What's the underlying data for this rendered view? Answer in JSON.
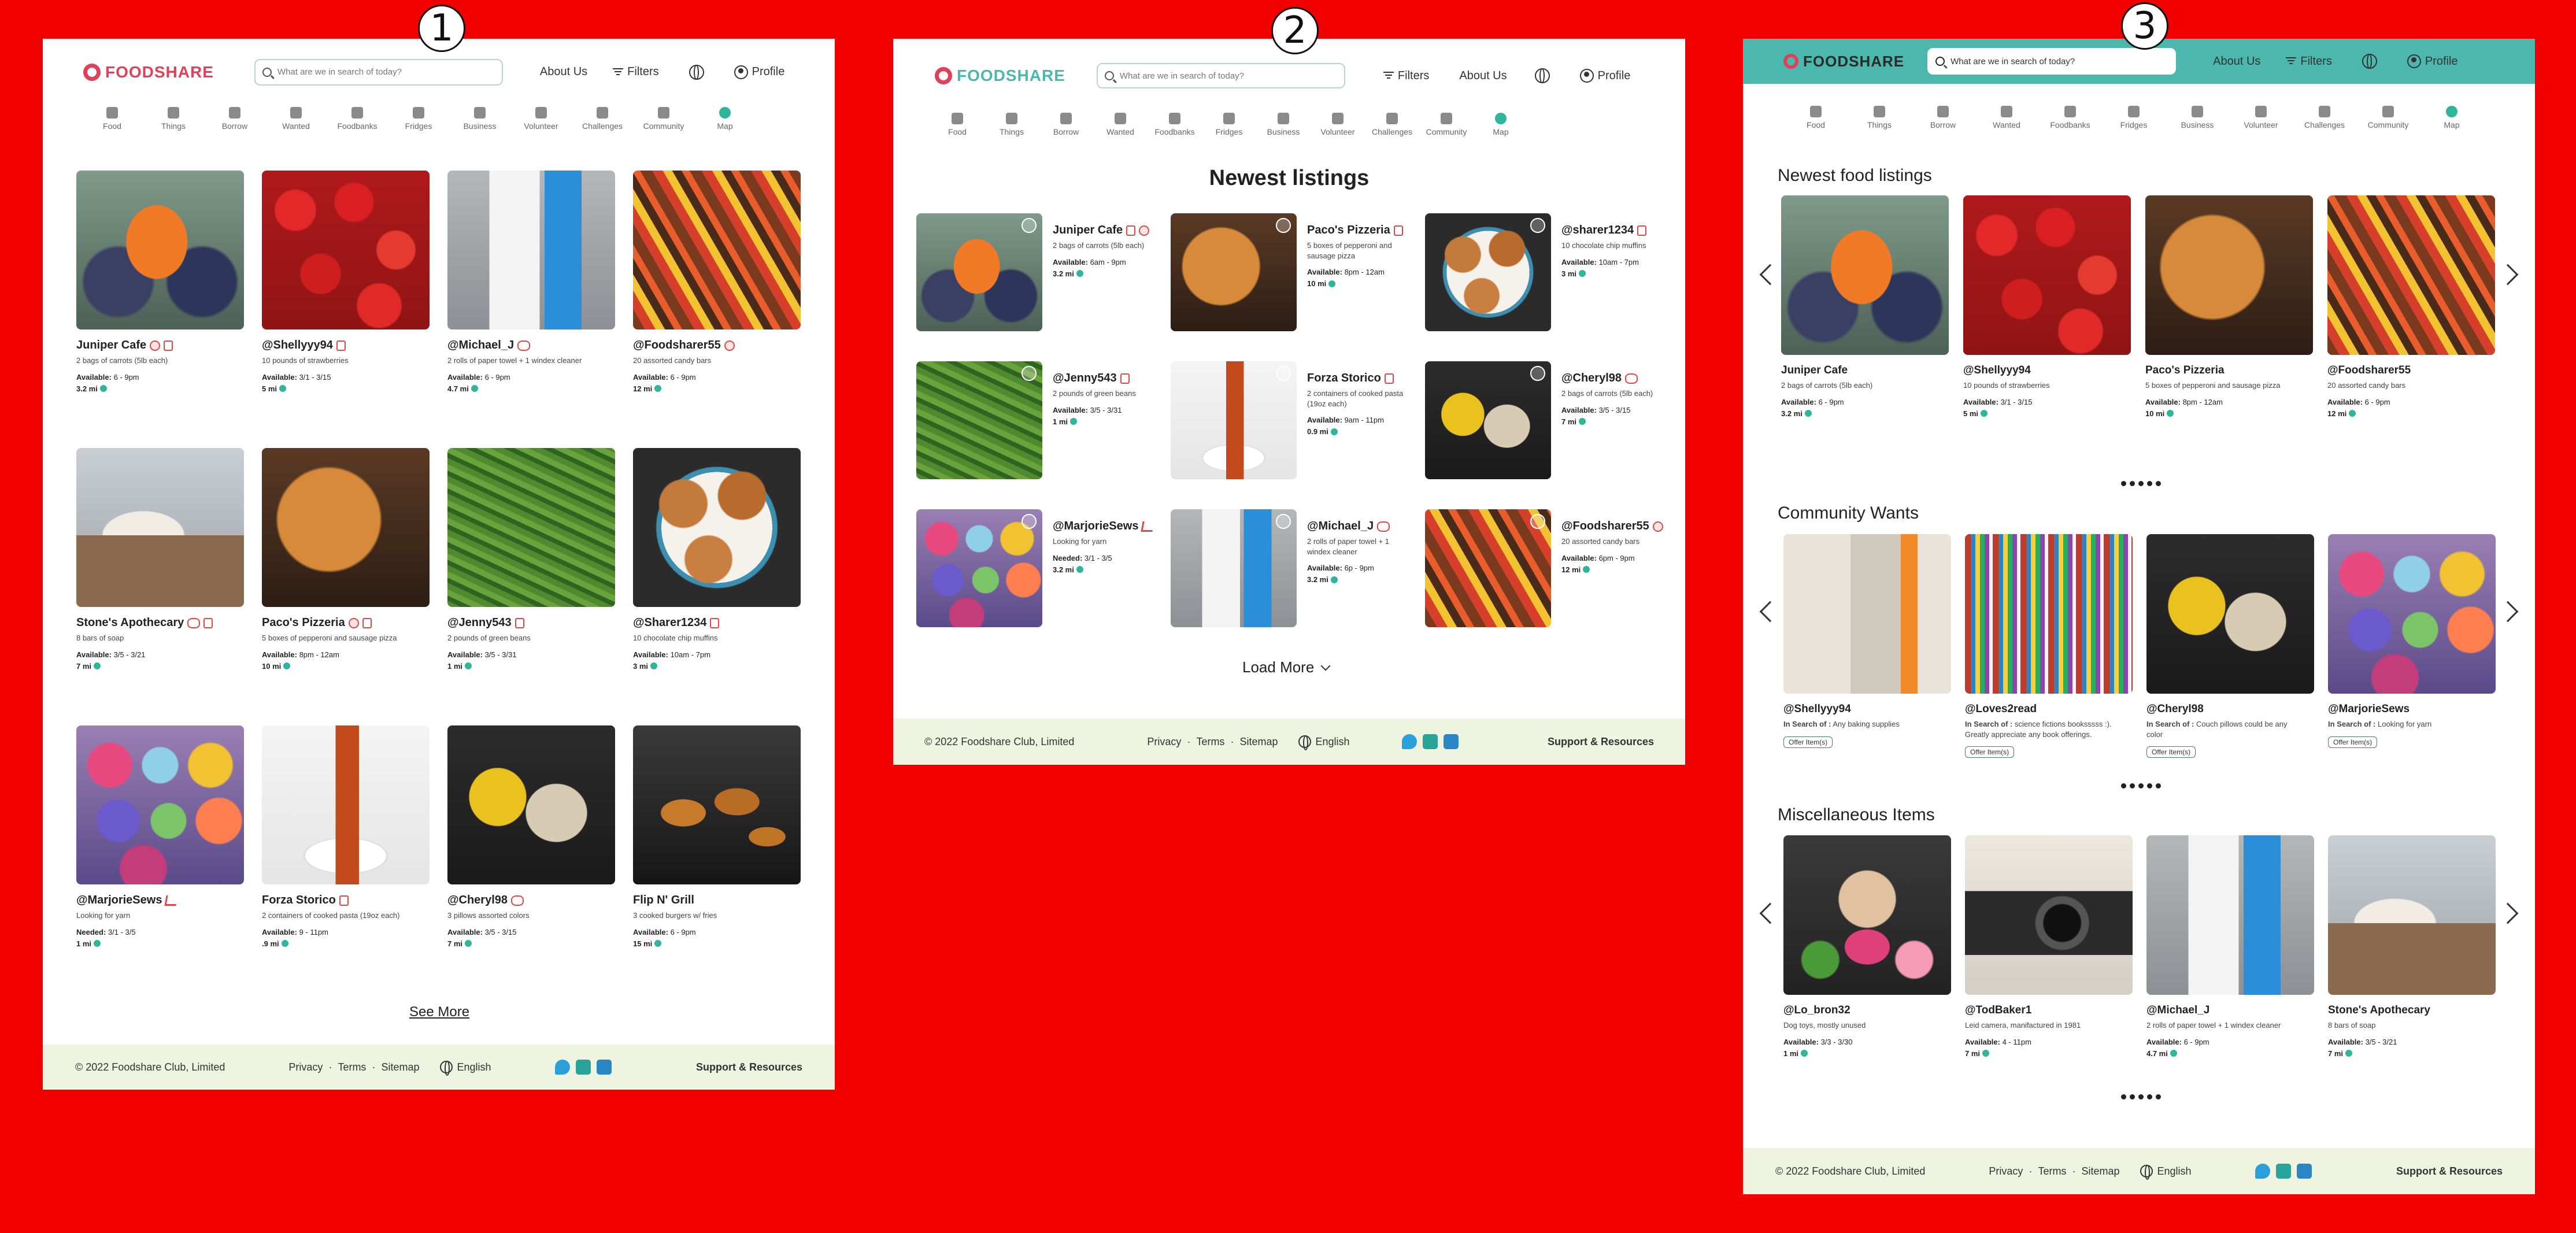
{
  "badges": [
    "1",
    "2",
    "3"
  ],
  "brand": {
    "name": "FOODSHARE",
    "primary": "#e0405a",
    "teal": "#2fb59c",
    "teal_header": "#4cb7ad"
  },
  "search": {
    "placeholder": "What are we in search of today?"
  },
  "nav": {
    "about": "About Us",
    "filters": "Filters",
    "profile": "Profile"
  },
  "categories": [
    "Food",
    "Things",
    "Borrow",
    "Wanted",
    "Foodbanks",
    "Fridges",
    "Business",
    "Volunteer",
    "Challenges",
    "Community",
    "Map"
  ],
  "footer": {
    "copyright": "© 2022 Foodshare Club, Limited",
    "privacy": "Privacy",
    "terms": "Terms",
    "sitemap": "Sitemap",
    "language": "English",
    "support": "Support & Resources"
  },
  "mock1": {
    "see_more": "See More",
    "listings": [
      {
        "title": "Juniper Cafe",
        "desc": "2 bags of carrots (5lb each)",
        "label": "Available:",
        "time": "6 - 9pm",
        "dist": "3.2 mi",
        "img": "carrots"
      },
      {
        "title": "@Shellyyy94",
        "desc": "10 pounds of strawberries",
        "label": "Available:",
        "time": "3/1 - 3/15",
        "dist": "5 mi",
        "img": "strawberries"
      },
      {
        "title": "@Michael_J",
        "desc": "2 rolls of paper towel + 1 windex cleaner",
        "label": "Available:",
        "time": "6 - 9pm",
        "dist": "4.7 mi",
        "img": "cleaner"
      },
      {
        "title": "@Foodsharer55",
        "desc": "20 assorted candy bars",
        "label": "Available:",
        "time": "6 - 9pm",
        "dist": "12 mi",
        "img": "candy"
      },
      {
        "title": "Stone's Apothecary",
        "desc": "8 bars of soap",
        "label": "Available:",
        "time": "3/5 - 3/21",
        "dist": "7 mi",
        "img": "soap"
      },
      {
        "title": "Paco's Pizzeria",
        "desc": "5 boxes of pepperoni and sausage pizza",
        "label": "Available:",
        "time": "8pm - 12am",
        "dist": "10 mi",
        "img": "pizza"
      },
      {
        "title": "@Jenny543",
        "desc": "2 pounds of green beans",
        "label": "Available:",
        "time": "3/5 - 3/31",
        "dist": "1 mi",
        "img": "beans"
      },
      {
        "title": "@Sharer1234",
        "desc": "10 chocolate chip muffins",
        "label": "Available:",
        "time": "10am - 7pm",
        "dist": "3 mi",
        "img": "muffins"
      },
      {
        "title": "@MarjorieSews",
        "desc": "Looking for yarn",
        "label": "Needed:",
        "time": "3/1 - 3/5",
        "dist": "1 mi",
        "img": "yarn"
      },
      {
        "title": "Forza Storico",
        "desc": "2 containers of cooked pasta (19oz each)",
        "label": "Available:",
        "time": "9 - 11pm",
        "dist": ".9 mi",
        "img": "pasta"
      },
      {
        "title": "@Cheryl98",
        "desc": "3 pillows assorted colors",
        "label": "Available:",
        "time": "3/5 - 3/15",
        "dist": "7 mi",
        "img": "pillows"
      },
      {
        "title": "Flip N' Grill",
        "desc": "3 cooked burgers w/ fries",
        "label": "Available:",
        "time": "6 - 9pm",
        "dist": "15 mi",
        "img": "burgers"
      }
    ]
  },
  "mock2": {
    "title": "Newest listings",
    "load_more": "Load More",
    "listings": [
      {
        "title": "Juniper Cafe",
        "desc": "2 bags of carrots (5lb each)",
        "label": "Available:",
        "time": "6am - 9pm",
        "dist": "3.2 mi",
        "img": "carrots"
      },
      {
        "title": "Paco's Pizzeria",
        "desc": "5 boxes of pepperoni and sausage pizza",
        "label": "Available:",
        "time": "8pm - 12am",
        "dist": "10 mi",
        "img": "pizza"
      },
      {
        "title": "@sharer1234",
        "desc": "10 chocolate chip muffins",
        "label": "Available:",
        "time": "10am - 7pm",
        "dist": "3 mi",
        "img": "muffins"
      },
      {
        "title": "@Jenny543",
        "desc": "2 pounds of green beans",
        "label": "Available:",
        "time": "3/5 - 3/31",
        "dist": "1 mi",
        "img": "beans"
      },
      {
        "title": "Forza Storico",
        "desc": "2 containers of cooked pasta (19oz each)",
        "label": "Available:",
        "time": "9am - 11pm",
        "dist": "0.9 mi",
        "img": "pasta"
      },
      {
        "title": "@Cheryl98",
        "desc": "2 bags of carrots (5lb each)",
        "label": "Available:",
        "time": "3/5 - 3/15",
        "dist": "7 mi",
        "img": "pillows"
      },
      {
        "title": "@MarjorieSews",
        "desc": "Looking for yarn",
        "label": "Needed:",
        "time": "3/1 - 3/5",
        "dist": "3.2 mi",
        "img": "yarn"
      },
      {
        "title": "@Michael_J",
        "desc": "2 rolls of paper towel + 1 windex cleaner",
        "label": "Available:",
        "time": "6p - 9pm",
        "dist": "3.2 mi",
        "img": "cleaner"
      },
      {
        "title": "@Foodsharer55",
        "desc": "20 assorted candy bars",
        "label": "Available:",
        "time": "6pm - 9pm",
        "dist": "12 mi",
        "img": "candy"
      }
    ]
  },
  "mock3": {
    "food_title": "Newest food listings",
    "wants_title": "Community Wants",
    "misc_title": "Miscellaneous Items",
    "offer_label": "Offer Item(s)",
    "search_label": "In Search of :",
    "food": [
      {
        "title": "Juniper Cafe",
        "desc": "2 bags of carrots (5lb each)",
        "label": "Available:",
        "time": "6 - 9pm",
        "dist": "3.2 mi",
        "img": "carrots"
      },
      {
        "title": "@Shellyyy94",
        "desc": "10 pounds of strawberries",
        "label": "Available:",
        "time": "3/1 - 3/15",
        "dist": "5 mi",
        "img": "strawberries"
      },
      {
        "title": "Paco's Pizzeria",
        "desc": "5 boxes of pepperoni and sausage pizza",
        "label": "Available:",
        "time": "8pm - 12am",
        "dist": "10 mi",
        "img": "pizza"
      },
      {
        "title": "@Foodsharer55",
        "desc": "20 assorted candy bars",
        "label": "Available:",
        "time": "6 - 9pm",
        "dist": "12 mi",
        "img": "candy"
      }
    ],
    "wants": [
      {
        "title": "@Shellyyy94",
        "desc": "Any baking supplies",
        "img": "baking"
      },
      {
        "title": "@Loves2read",
        "desc": "science fictions booksssss :). Greatly appreciate any book offerings.",
        "img": "books"
      },
      {
        "title": "@Cheryl98",
        "desc": "Couch pillows could be any color",
        "img": "pillows"
      },
      {
        "title": "@MarjorieSews",
        "desc": "Looking for yarn",
        "img": "yarn"
      }
    ],
    "misc": [
      {
        "title": "@Lo_bron32",
        "desc": "Dog toys, mostly unused",
        "label": "Available:",
        "time": "3/3 - 3/30",
        "dist": "1 mi",
        "img": "dog"
      },
      {
        "title": "@TodBaker1",
        "desc": "Leid camera, manifactured in 1981",
        "label": "Available:",
        "time": "4 - 11pm",
        "dist": "7 mi",
        "img": "camera"
      },
      {
        "title": "@Michael_J",
        "desc": "2 rolls of paper towel + 1 windex cleaner",
        "label": "Available:",
        "time": "6 - 9pm",
        "dist": "4.7 mi",
        "img": "cleaner"
      },
      {
        "title": "Stone's Apothecary",
        "desc": "8 bars of soap",
        "label": "Available:",
        "time": "3/5 - 3/21",
        "dist": "7 mi",
        "img": "soap"
      }
    ]
  }
}
